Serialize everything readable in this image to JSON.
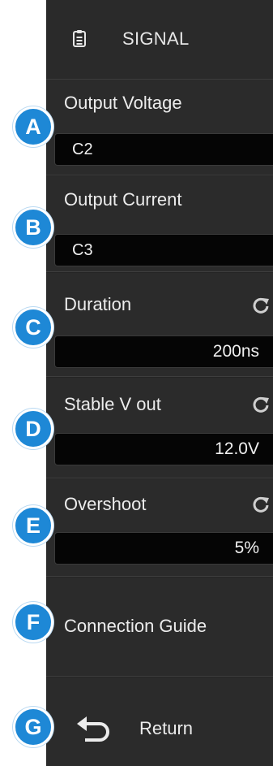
{
  "header": {
    "title": "SIGNAL",
    "icon": "clipboard-icon"
  },
  "items": [
    {
      "label": "Output Voltage",
      "value": "C2"
    },
    {
      "label": "Output Current",
      "value": "C3"
    },
    {
      "label": "Duration",
      "value": "200ns",
      "icon": "refresh-icon"
    },
    {
      "label": "Stable V out",
      "value": "12.0V",
      "icon": "refresh-icon"
    },
    {
      "label": "Overshoot",
      "value": "5%",
      "icon": "refresh-icon"
    },
    {
      "label": "Connection Guide"
    },
    {
      "label": "Return",
      "icon": "return-arrow-icon"
    }
  ],
  "badges": [
    "A",
    "B",
    "C",
    "D",
    "E",
    "F",
    "G"
  ],
  "colors": {
    "panel": "#252525",
    "value_box": "#050505",
    "badge": "#1e88d6",
    "text": "#ececec"
  }
}
